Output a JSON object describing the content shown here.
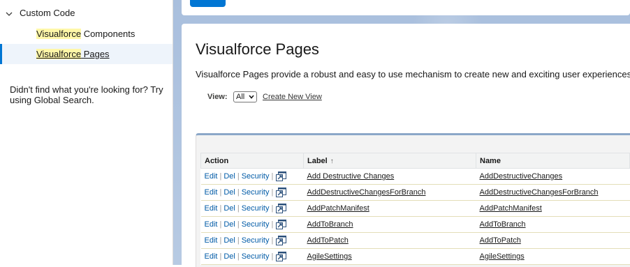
{
  "sidebar": {
    "parent_label": "Custom Code",
    "items": [
      {
        "highlight": "Visualforce",
        "rest": " Components"
      },
      {
        "highlight": "Visualforce",
        "rest": " Pages"
      }
    ],
    "search_hint": "Didn't find what you're looking for? Try using Global Search."
  },
  "page": {
    "title": "Visualforce Pages",
    "description": "Visualforce Pages provide a robust and easy to use mechanism to create new and exciting user experiences for yo"
  },
  "view": {
    "label": "View:",
    "selected": "All",
    "create_link": "Create New View"
  },
  "table": {
    "headers": {
      "action": "Action",
      "label": "Label",
      "name": "Name"
    },
    "sort_indicator": "↑",
    "actions": {
      "edit": "Edit",
      "del": "Del",
      "security": "Security",
      "sep": "|"
    },
    "rows": [
      {
        "label": "Add Destructive Changes",
        "name": "AddDestructiveChanges"
      },
      {
        "label": "AddDestructiveChangesForBranch",
        "name": "AddDestructiveChangesForBranch"
      },
      {
        "label": "AddPatchManifest",
        "name": "AddPatchManifest"
      },
      {
        "label": "AddToBranch",
        "name": "AddToBranch"
      },
      {
        "label": "AddToPatch",
        "name": "AddToPatch"
      },
      {
        "label": "AgileSettings",
        "name": "AgileSettings"
      }
    ]
  },
  "colors": {
    "accent": "#0176d3",
    "highlight": "#fef7a8",
    "action_link": "#015ba7",
    "page_background": "#b0c4df"
  },
  "icons": {
    "tree_toggle": "chevron-down-icon",
    "row_popout": "popout-window-icon",
    "view_dropdown": "caret-down-icon"
  }
}
